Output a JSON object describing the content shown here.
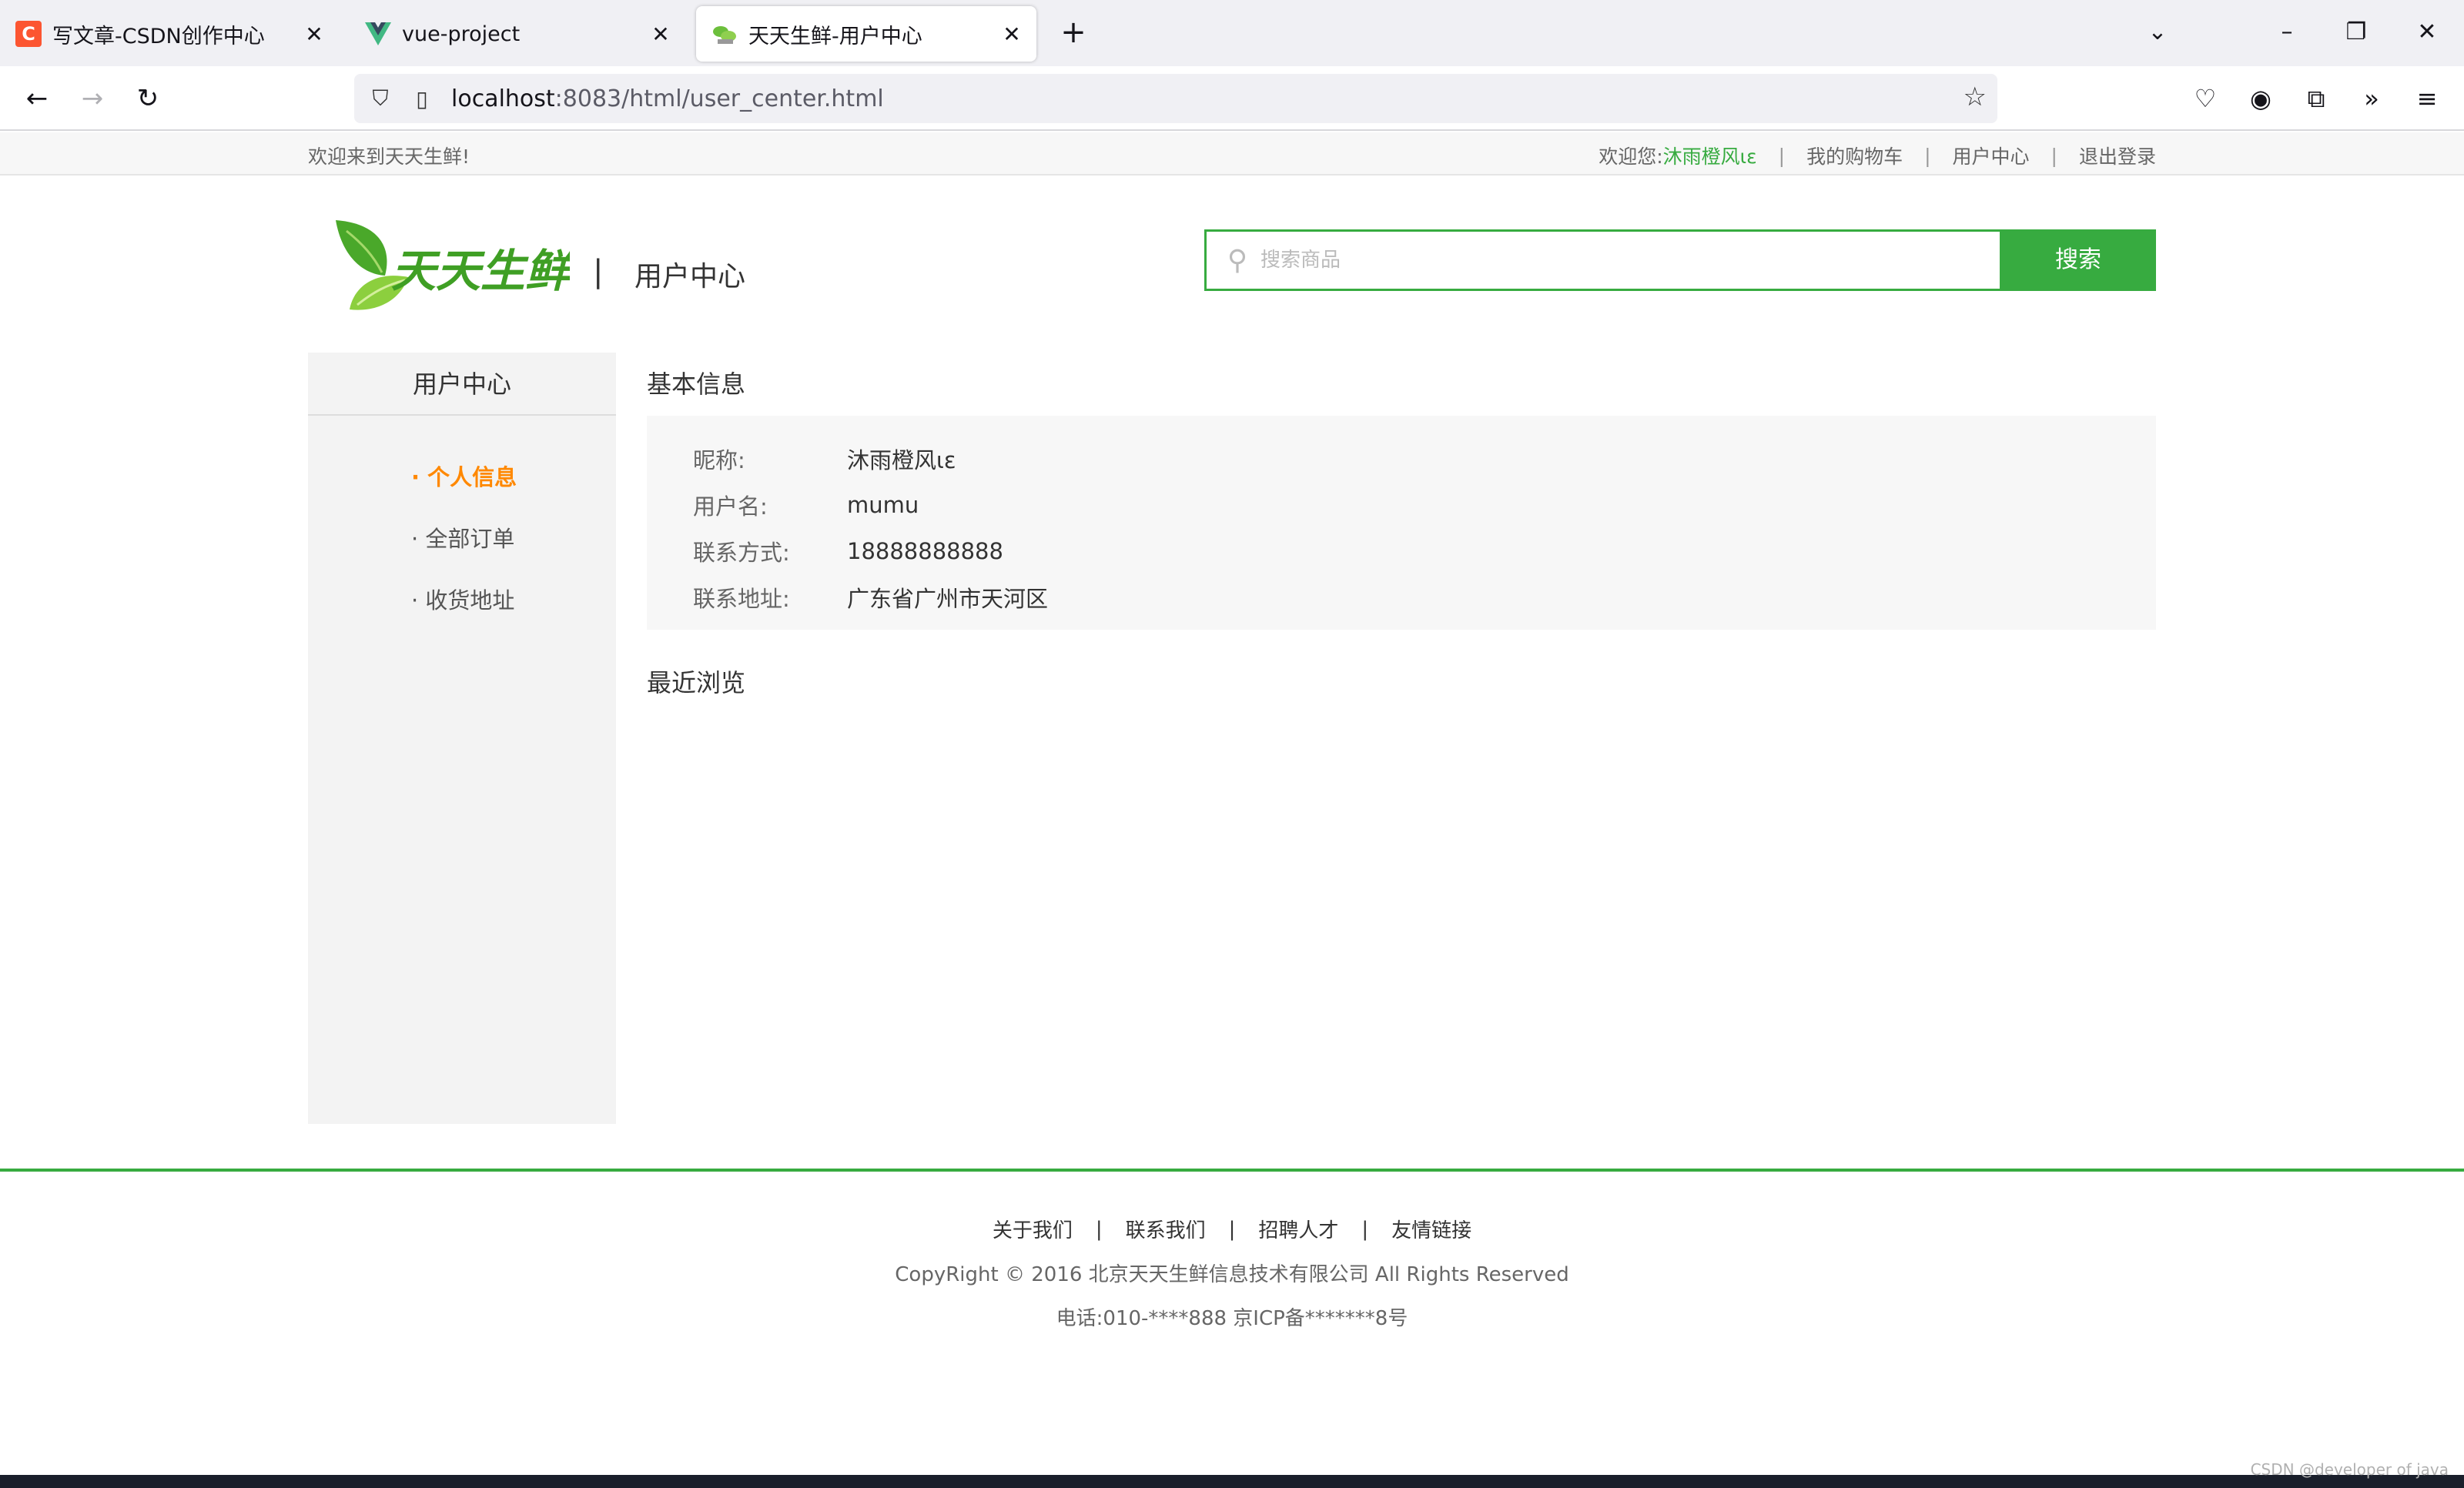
{
  "browser": {
    "tabs": [
      {
        "title": "写文章-CSDN创作中心",
        "icon": "csdn-logo-icon"
      },
      {
        "title": "vue-project",
        "icon": "vue-logo-icon"
      },
      {
        "title": "天天生鲜-用户中心",
        "icon": "site-favicon-icon"
      }
    ],
    "url_host": "localhost",
    "url_rest": ":8083/html/user_center.html"
  },
  "topbar": {
    "welcome": "欢迎来到天天生鲜!",
    "greeting": "欢迎您:",
    "username": "沐雨橙风ιε",
    "cart": "我的购物车",
    "user_center": "用户中心",
    "logout": "退出登录"
  },
  "header": {
    "logo_text": "天天生鲜",
    "divider": "|",
    "subtitle": "用户中心",
    "search_placeholder": "搜索商品",
    "search_button": "搜索"
  },
  "sidebar": {
    "title": "用户中心",
    "items": [
      {
        "label": "· 个人信息"
      },
      {
        "label": "· 全部订单"
      },
      {
        "label": "· 收货地址"
      }
    ]
  },
  "main": {
    "basic_title": "基本信息",
    "fields": [
      {
        "key": "昵称:",
        "value": "沐雨橙风ιε"
      },
      {
        "key": "用户名:",
        "value": "mumu"
      },
      {
        "key": "联系方式:",
        "value": "18888888888"
      },
      {
        "key": "联系地址:",
        "value": "广东省广州市天河区"
      }
    ],
    "recent_title": "最近浏览"
  },
  "footer": {
    "links": [
      "关于我们",
      "联系我们",
      "招聘人才",
      "友情链接"
    ],
    "copyright": "CopyRight © 2016 北京天天生鲜信息技术有限公司 All Rights Reserved",
    "phone": "电话:010-****888 京ICP备*******8号"
  },
  "watermark": "CSDN @developer of java",
  "colors": {
    "accent": "#37ab40",
    "active": "#ff8800"
  }
}
